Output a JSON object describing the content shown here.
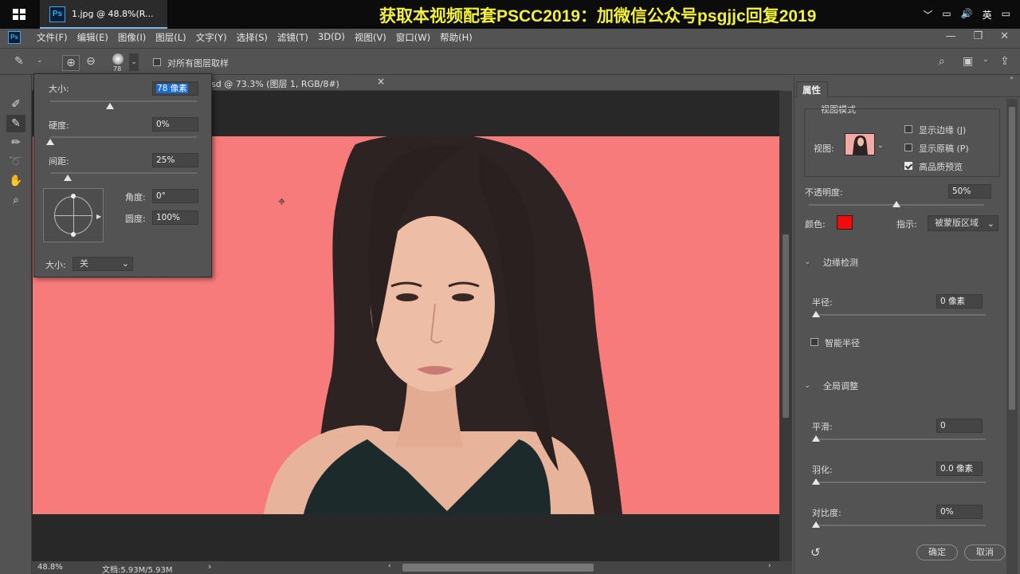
{
  "taskbar": {
    "task_title": "1.jpg @ 48.8%(R...",
    "banner": "获取本视频配套PSCC2019：加微信公众号psgjjc回复2019",
    "tray": {
      "chevron": "﹀",
      "network": "▭",
      "volume": "🔊",
      "ime": "英",
      "notify": "▭"
    }
  },
  "menubar": {
    "items": [
      "文件(F)",
      "编辑(E)",
      "图像(I)",
      "图层(L)",
      "文字(Y)",
      "选择(S)",
      "滤镜(T)",
      "3D(D)",
      "视图(V)",
      "窗口(W)",
      "帮助(H)"
    ]
  },
  "options_bar": {
    "brush_size": "78",
    "sample_all_label": "对所有图层取样"
  },
  "document": {
    "tab_title": "sd @ 73.3% (图层 1, RGB/8#)",
    "tab_close": "×"
  },
  "status": {
    "zoom": "48.8%",
    "doc_info": "文档:5.93M/5.93M",
    "arrow": "›"
  },
  "brush_popup": {
    "size_label": "大小:",
    "size_value": "78 像素",
    "size_slider": 0.41,
    "hardness_label": "硬度:",
    "hardness_value": "0%",
    "hardness_slider": 0.0,
    "spacing_label": "间距:",
    "spacing_value": "25%",
    "spacing_slider": 0.12,
    "angle_label": "角度:",
    "angle_value": "0°",
    "roundness_label": "圆度:",
    "roundness_value": "100%",
    "size_control_label": "大小:",
    "size_control_value": "关"
  },
  "properties": {
    "tab": "属性",
    "view_mode_title": "视图模式",
    "view_label": "视图:",
    "show_edge": "显示边缘 (J)",
    "show_original": "显示原稿 (P)",
    "high_quality": "高品质预览",
    "high_quality_checked": true,
    "opacity_label": "不透明度:",
    "opacity_value": "50%",
    "opacity_slider": 0.5,
    "color_label": "颜色:",
    "color": "#f40a0a",
    "indicate_label": "指示:",
    "indicate_value": "被蒙版区域",
    "edge_detection": "边缘检测",
    "radius_label": "半径:",
    "radius_value": "0 像素",
    "smart_radius": "智能半径",
    "global_refine": "全局调整",
    "smooth_label": "平滑:",
    "smooth_value": "0",
    "feather_label": "羽化:",
    "feather_value": "0.0 像素",
    "contrast_label": "对比度:",
    "contrast_value": "0%",
    "ok": "确定",
    "cancel": "取消"
  }
}
